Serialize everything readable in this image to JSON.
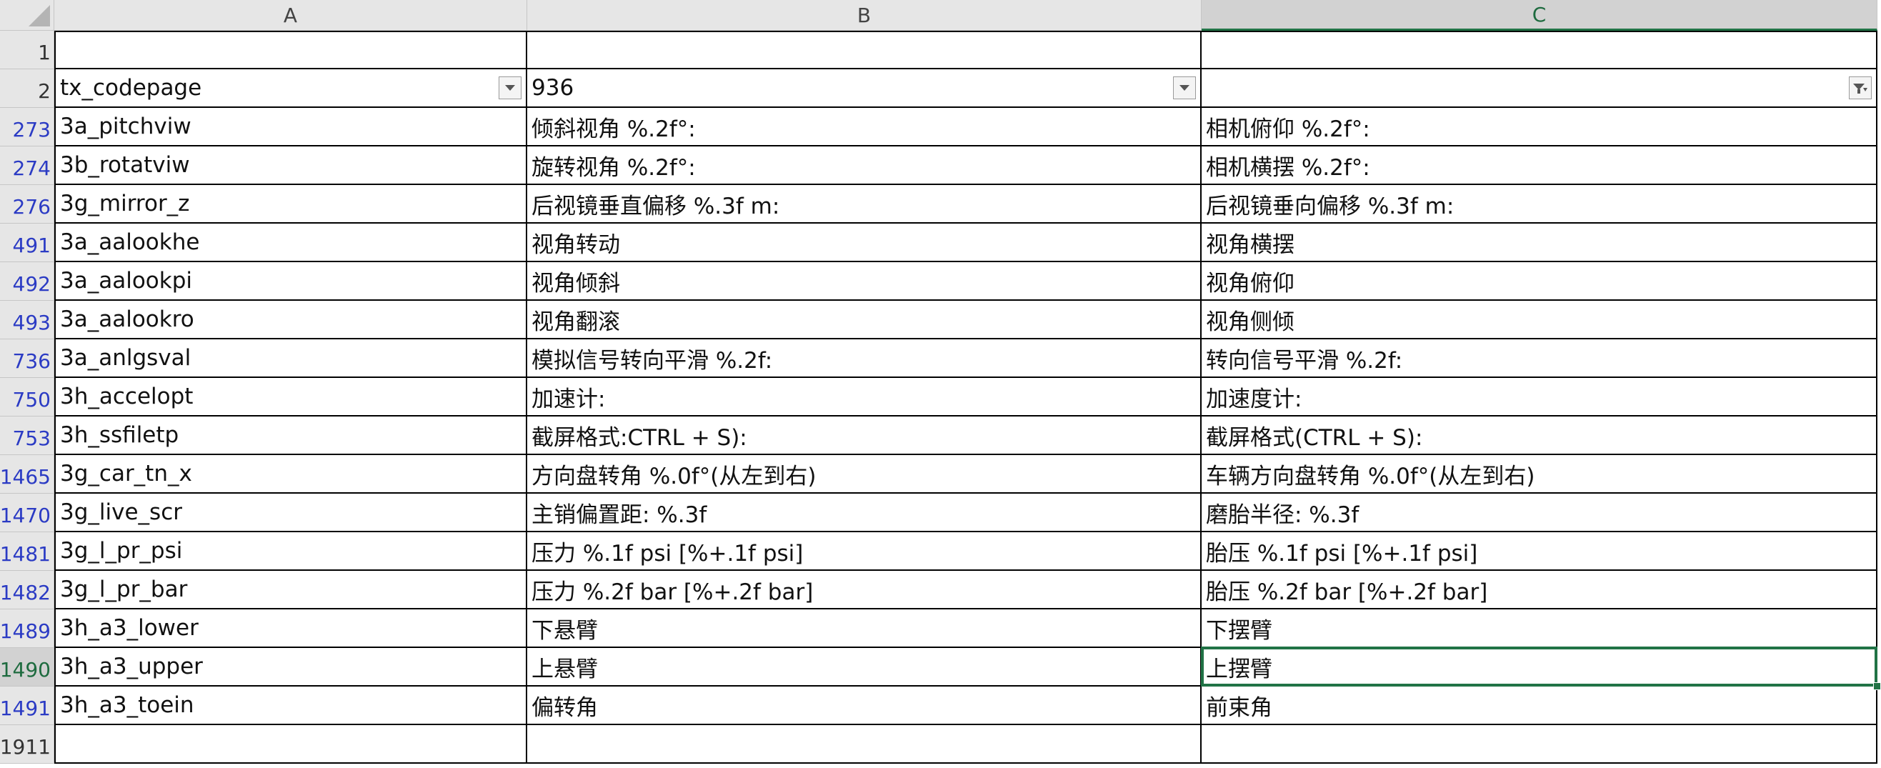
{
  "spreadsheet": {
    "columns": [
      {
        "label": "A",
        "active": false
      },
      {
        "label": "B",
        "active": false
      },
      {
        "label": "C",
        "active": true
      }
    ],
    "rows": [
      {
        "num": "1",
        "cells": [
          "",
          "",
          ""
        ],
        "filtered": false
      },
      {
        "num": "2",
        "cells": [
          "tx_codepage",
          "936",
          ""
        ],
        "filtered": false,
        "header_row": true
      },
      {
        "num": "273",
        "cells": [
          "3a_pitchviw",
          "倾斜视角 %.2f°:",
          "相机俯仰 %.2f°:"
        ],
        "filtered": true
      },
      {
        "num": "274",
        "cells": [
          "3b_rotatviw",
          "旋转视角 %.2f°:",
          "相机横摆 %.2f°:"
        ],
        "filtered": true
      },
      {
        "num": "276",
        "cells": [
          "3g_mirror_z",
          "后视镜垂直偏移 %.3f m:",
          "后视镜垂向偏移 %.3f m:"
        ],
        "filtered": true
      },
      {
        "num": "491",
        "cells": [
          "3a_aalookhe",
          "视角转动",
          "视角横摆"
        ],
        "filtered": true
      },
      {
        "num": "492",
        "cells": [
          "3a_aalookpi",
          "视角倾斜",
          "视角俯仰"
        ],
        "filtered": true
      },
      {
        "num": "493",
        "cells": [
          "3a_aalookro",
          "视角翻滚",
          "视角侧倾"
        ],
        "filtered": true
      },
      {
        "num": "736",
        "cells": [
          "3a_anlgsval",
          "模拟信号转向平滑 %.2f:",
          "转向信号平滑 %.2f:"
        ],
        "filtered": true
      },
      {
        "num": "750",
        "cells": [
          "3h_accelopt",
          "加速计:",
          "加速度计:"
        ],
        "filtered": true
      },
      {
        "num": "753",
        "cells": [
          "3h_ssfiletp",
          "截屏格式:CTRL + S):",
          "截屏格式(CTRL + S):"
        ],
        "filtered": true
      },
      {
        "num": "1465",
        "cells": [
          "3g_car_tn_x",
          "方向盘转角 %.0f°(从左到右)",
          "车辆方向盘转角 %.0f°(从左到右)"
        ],
        "filtered": true
      },
      {
        "num": "1470",
        "cells": [
          "3g_live_scr",
          "主销偏置距: %.3f",
          "磨胎半径: %.3f"
        ],
        "filtered": true
      },
      {
        "num": "1481",
        "cells": [
          "3g_l_pr_psi",
          "压力 %.1f psi [%+.1f psi]",
          "胎压 %.1f psi [%+.1f psi]"
        ],
        "filtered": true
      },
      {
        "num": "1482",
        "cells": [
          "3g_l_pr_bar",
          "压力 %.2f bar [%+.2f bar]",
          "胎压 %.2f bar [%+.2f bar]"
        ],
        "filtered": true
      },
      {
        "num": "1489",
        "cells": [
          "3h_a3_lower",
          "下悬臂",
          "下摆臂"
        ],
        "filtered": true
      },
      {
        "num": "1490",
        "cells": [
          "3h_a3_upper",
          "上悬臂",
          "上摆臂"
        ],
        "filtered": true,
        "active": true
      },
      {
        "num": "1491",
        "cells": [
          "3h_a3_toein",
          "偏转角",
          "前束角"
        ],
        "filtered": true
      },
      {
        "num": "1911",
        "cells": [
          "",
          "",
          ""
        ],
        "filtered": false
      }
    ],
    "filter_icons": {
      "A": "dropdown-arrow-icon",
      "B": "dropdown-arrow-icon",
      "C": "filter-funnel-icon"
    },
    "selected_cell": {
      "row": "1490",
      "col": "C"
    },
    "colors": {
      "header_bg": "#e6e6e6",
      "active_header_bg": "#d2d2d2",
      "selection": "#217346",
      "filtered_row_number": "#2b3bc4"
    }
  }
}
